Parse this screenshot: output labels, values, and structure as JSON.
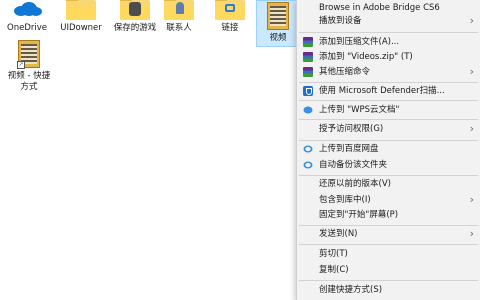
{
  "desktop": {
    "icons": [
      {
        "label": "OneDrive",
        "icon": "onedrive-icon"
      },
      {
        "label": "UIDowner",
        "icon": "folder-icon"
      },
      {
        "label": "保存的游戏",
        "icon": "saved-games-icon"
      },
      {
        "label": "联系人",
        "icon": "contacts-icon"
      },
      {
        "label": "链接",
        "icon": "links-icon"
      },
      {
        "label": "视频",
        "icon": "video-folder-icon"
      },
      {
        "label": "视频 - 快捷",
        "label2": "方式",
        "icon": "video-shortcut-icon"
      }
    ]
  },
  "menu": {
    "items": [
      {
        "label": "Browse in Adobe Bridge CS6"
      },
      {
        "label": "播放到设备",
        "submenu": true
      },
      {
        "label": "添加到压缩文件(A)...",
        "icon": "winrar-icon"
      },
      {
        "label": "添加到 \"Videos.zip\" (T)",
        "icon": "winrar-icon"
      },
      {
        "label": "其他压缩命令",
        "icon": "winrar-icon",
        "submenu": true
      },
      {
        "label": "使用 Microsoft Defender扫描...",
        "icon": "defender-icon"
      },
      {
        "label": "上传到 \"WPS云文档\"",
        "icon": "wps-cloud-icon"
      },
      {
        "label": "授予访问权限(G)",
        "submenu": true
      },
      {
        "label": "上传到百度网盘",
        "icon": "baidu-netdisk-icon"
      },
      {
        "label": "自动备份该文件夹",
        "icon": "baidu-netdisk-icon"
      },
      {
        "label": "还原以前的版本(V)"
      },
      {
        "label": "包含到库中(I)",
        "submenu": true
      },
      {
        "label": "固定到\"开始\"屏幕(P)"
      },
      {
        "label": "发送到(N)",
        "submenu": true
      },
      {
        "label": "剪切(T)"
      },
      {
        "label": "复制(C)"
      },
      {
        "label": "创建快捷方式(S)"
      }
    ],
    "arrow_glyph": "›"
  },
  "colors": {
    "menu_bg": "#f2f2f2",
    "selection_bg": "#cce8ff",
    "folder": "#ffd95e"
  }
}
